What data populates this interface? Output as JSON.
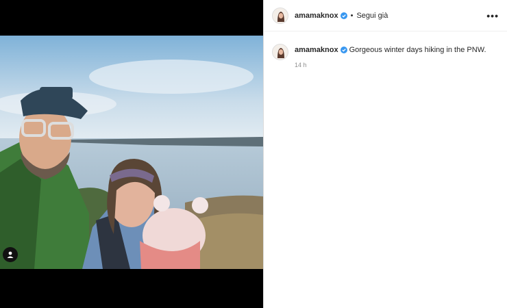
{
  "post": {
    "username": "amamaknox",
    "follow_status": "Segui già",
    "separator": "•",
    "more_label": "•••",
    "caption": "Gorgeous winter days hiking in the PNW.",
    "timestamp": "14 h"
  },
  "icons": {
    "verified": "verified-badge-icon",
    "tag": "user-tag-icon",
    "more": "more-options-icon"
  },
  "colors": {
    "verified": "#3897f0",
    "muted": "#8e8e8e"
  }
}
